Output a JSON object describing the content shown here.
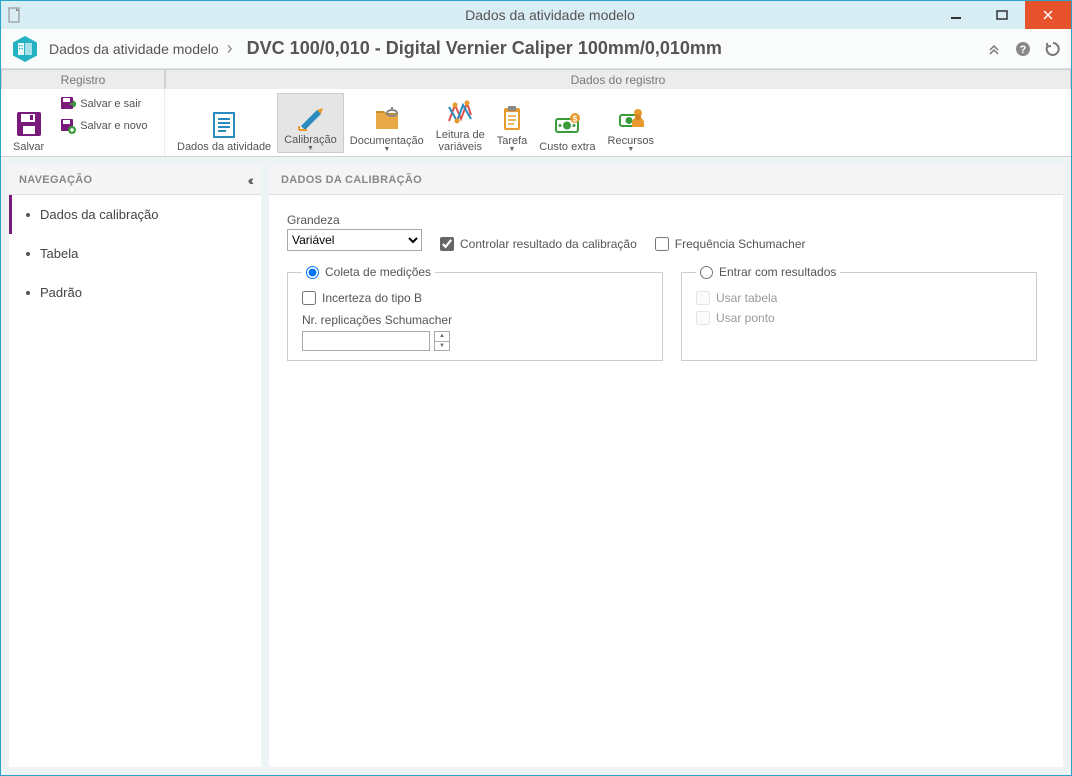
{
  "window": {
    "title": "Dados da atividade modelo"
  },
  "breadcrumb": {
    "root": "Dados da atividade modelo",
    "title": "DVC 100/0,010 - Digital Vernier Caliper 100mm/0,010mm"
  },
  "ribbon_tabs": {
    "registro": "Registro",
    "dados": "Dados do registro"
  },
  "ribbon": {
    "salvar": "Salvar",
    "salvar_sair": "Salvar e sair",
    "salvar_novo": "Salvar e novo",
    "dados_atividade": "Dados da atividade",
    "calibracao": "Calibração",
    "documentacao": "Documentação",
    "leitura_line1": "Leitura de",
    "leitura_line2": "variáveis",
    "tarefa": "Tarefa",
    "custo_extra": "Custo extra",
    "recursos": "Recursos"
  },
  "nav": {
    "header": "NAVEGAÇÃO",
    "items": [
      {
        "label": "Dados da calibração"
      },
      {
        "label": "Tabela"
      },
      {
        "label": "Padrão"
      }
    ]
  },
  "content": {
    "header": "DADOS DA CALIBRAÇÃO",
    "grandeza_label": "Grandeza",
    "grandeza_value": "Variável",
    "controlar_resultado": "Controlar resultado da calibração",
    "frequencia": "Frequência Schumacher",
    "coleta_legend": "Coleta de medições",
    "incerteza_b": "Incerteza do tipo B",
    "nr_replicacoes": "Nr. replicações Schumacher",
    "entrar_legend": "Entrar com resultados",
    "usar_tabela": "Usar tabela",
    "usar_ponto": "Usar ponto"
  }
}
